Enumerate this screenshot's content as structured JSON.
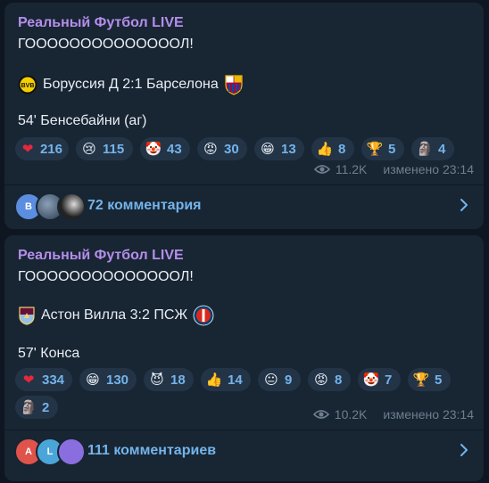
{
  "posts": [
    {
      "channel": "Реальный Футбол LIVE",
      "headline": "ГООООООООООООООЛ!",
      "score_line": "Боруссия Д 2:1 Барселона",
      "detail": "54' Бенсебайни (аг)",
      "reactions": [
        {
          "icon": "heart-icon",
          "glyph": "❤",
          "count": "216"
        },
        {
          "icon": "crying-face-icon",
          "glyph": "😢",
          "count": "115"
        },
        {
          "icon": "clown-icon",
          "glyph": "🤡",
          "count": "43"
        },
        {
          "icon": "angry-face-icon",
          "glyph": "😡",
          "count": "30"
        },
        {
          "icon": "grin-icon",
          "glyph": "😁",
          "count": "13"
        },
        {
          "icon": "thumbs-up-icon",
          "glyph": "👍",
          "count": "8"
        },
        {
          "icon": "trophy-icon",
          "glyph": "🏆",
          "count": "5"
        },
        {
          "icon": "moai-icon",
          "glyph": "🗿",
          "count": "4"
        }
      ],
      "views": "11.2K",
      "edited": "изменено 23:14",
      "comments_label": "72 комментария",
      "avatars": [
        "B",
        "",
        ""
      ]
    },
    {
      "channel": "Реальный Футбол LIVE",
      "headline": "ГООООООООООООООЛ!",
      "score_line": "Астон Вилла 3:2 ПСЖ",
      "detail": "57' Конса",
      "reactions": [
        {
          "icon": "heart-icon",
          "glyph": "❤",
          "count": "334"
        },
        {
          "icon": "grin-icon",
          "glyph": "😁",
          "count": "130"
        },
        {
          "icon": "devil-icon",
          "glyph": "😈",
          "count": "18"
        },
        {
          "icon": "thumbs-up-icon",
          "glyph": "👍",
          "count": "14"
        },
        {
          "icon": "neutral-face-icon",
          "glyph": "😐",
          "count": "9"
        },
        {
          "icon": "angry-face-icon",
          "glyph": "😡",
          "count": "8"
        },
        {
          "icon": "clown-icon",
          "glyph": "🤡",
          "count": "7"
        },
        {
          "icon": "trophy-icon",
          "glyph": "🏆",
          "count": "5"
        },
        {
          "icon": "moai-icon",
          "glyph": "🗿",
          "count": "2"
        }
      ],
      "views": "10.2K",
      "edited": "изменено 23:14",
      "comments_label": "111 комментариев",
      "avatars": [
        "A",
        "L",
        ""
      ]
    }
  ],
  "colors": {
    "background": "#0e1621",
    "bubble": "#182533",
    "channel_name": "#b48eea",
    "accent": "#74b4ea",
    "reaction_bg": "#233447",
    "meta": "#6d7f8f"
  }
}
